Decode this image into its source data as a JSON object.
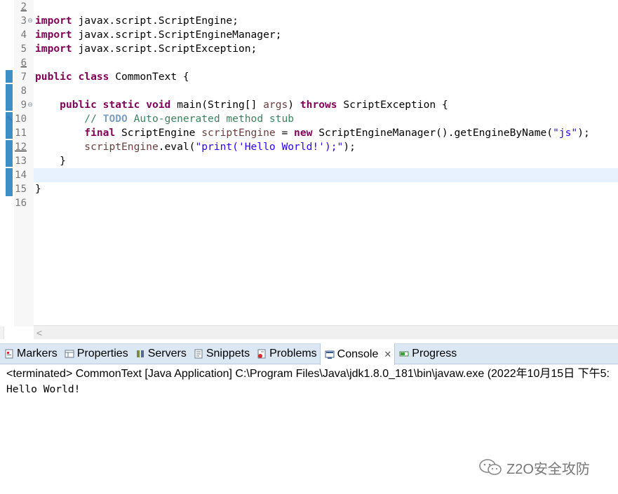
{
  "editor": {
    "line_numbers": [
      "2",
      "3",
      "4",
      "5",
      "6",
      "7",
      "8",
      "9",
      "10",
      "11",
      "12",
      "13",
      "14",
      "15",
      "16"
    ],
    "lines": {
      "l3": {
        "kw": "import",
        "rest": " javax.script.ScriptEngine;"
      },
      "l4": {
        "kw": "import",
        "rest": " javax.script.ScriptEngineManager;"
      },
      "l5": {
        "kw": "import",
        "rest": " javax.script.ScriptException;"
      },
      "l7": {
        "kw1": "public",
        "kw2": "class",
        "rest": " CommonText {"
      },
      "l9": {
        "indent": "    ",
        "kw1": "public",
        "kw2": "static",
        "kw3": "void",
        "mid": " main(String[] ",
        "var": "args",
        "mid2": ") ",
        "kw4": "throws",
        "rest": " ScriptException {"
      },
      "l10": {
        "indent": "        ",
        "cmt1": "// ",
        "todo": "TODO",
        "cmt2": " Auto-generated method stub"
      },
      "l11": {
        "indent": "        ",
        "kw1": "final",
        "mid": " ScriptEngine ",
        "var": "scriptEngine",
        "mid2": " = ",
        "kw2": "new",
        "mid3": " ScriptEngineManager().getEngineByName(",
        "str": "\"js\"",
        "rest": ");"
      },
      "l12": {
        "indent": "        ",
        "var": "scriptEngine",
        "mid": ".eval(",
        "str": "\"print('Hello World!');\"",
        "rest": ");"
      },
      "l13": {
        "text": "    }"
      },
      "l15": {
        "text": "}"
      }
    },
    "scroll_left_glyph": "<"
  },
  "panel": {
    "tabs": [
      {
        "label": "Markers"
      },
      {
        "label": "Properties"
      },
      {
        "label": "Servers"
      },
      {
        "label": "Snippets"
      },
      {
        "label": "Problems"
      },
      {
        "label": "Console",
        "close": "✕"
      },
      {
        "label": "Progress"
      }
    ],
    "console": {
      "terminated": "<terminated> CommonText [Java Application] C:\\Program Files\\Java\\jdk1.8.0_181\\bin\\javaw.exe (2022年10月15日 下午5:",
      "output": "Hello World!"
    }
  },
  "watermark": {
    "text": "Z2O安全攻防"
  },
  "colors": {
    "keyword": "#7f0055",
    "string": "#2a00ff",
    "comment": "#3f7f5f",
    "todo": "#7f9fbf",
    "local_var": "#6a3e3e",
    "ruler": "#3f8fc7",
    "current_line": "#e8f2fe",
    "tabbar": "#dbe7f3"
  }
}
